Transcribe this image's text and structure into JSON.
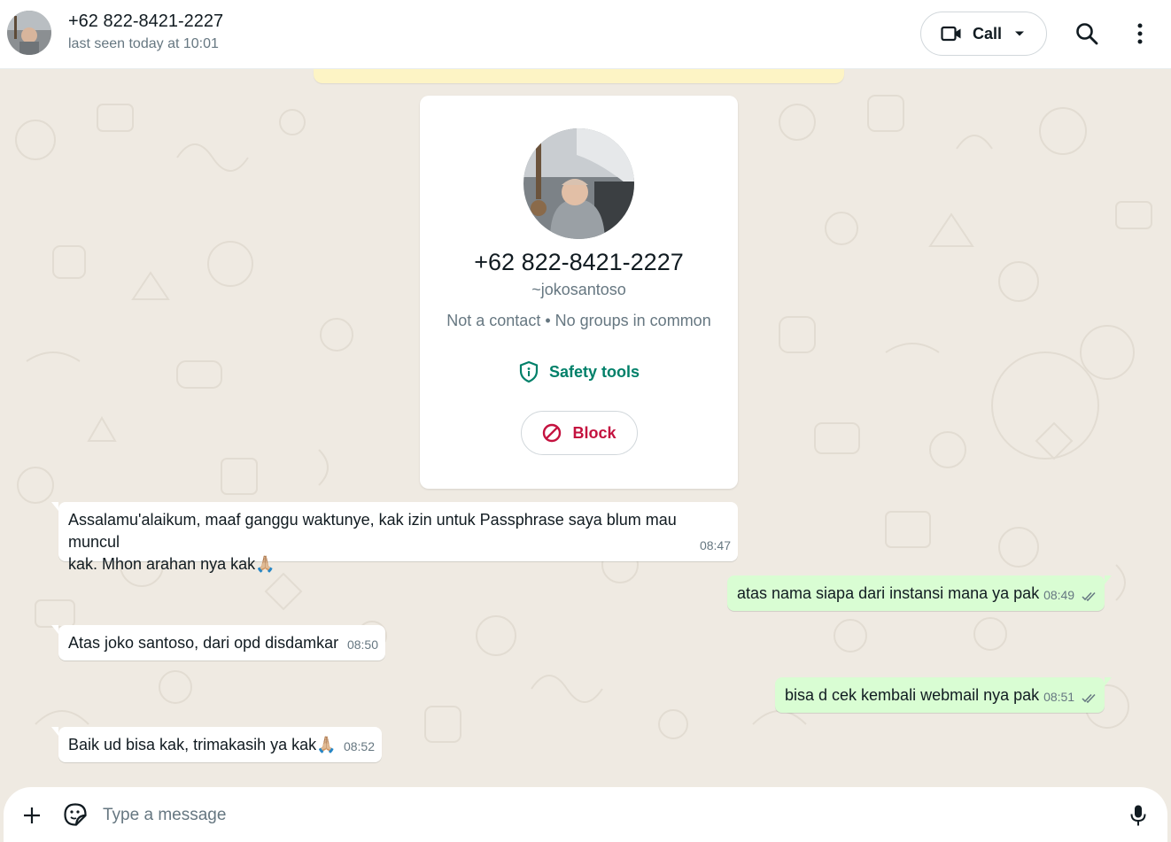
{
  "header": {
    "contact_name": "+62 822-8421-2227",
    "status": "last seen today at 10:01",
    "call_label": "Call"
  },
  "card": {
    "phone": "+62 822-8421-2227",
    "username": "~jokosantoso",
    "info": "Not a contact • No groups in common",
    "safety_label": "Safety tools",
    "block_label": "Block"
  },
  "messages": [
    {
      "direction": "in",
      "lines": [
        "Assalamu'alaikum, maaf ganggu waktunye, kak izin untuk Passphrase saya blum mau muncul",
        "kak. Mhon arahan nya kak🙏🏼"
      ],
      "time": "08:47"
    },
    {
      "direction": "out",
      "text": "atas nama siapa dari instansi mana ya pak",
      "time": "08:49"
    },
    {
      "direction": "in",
      "text": "Atas joko santoso, dari opd disdamkar",
      "time": "08:50"
    },
    {
      "direction": "out",
      "text": "bisa d cek kembali webmail nya pak",
      "time": "08:51"
    },
    {
      "direction": "in",
      "text": "Baik ud bisa kak, trimakasih ya kak🙏🏼",
      "time": "08:52"
    }
  ],
  "composer": {
    "placeholder": "Type a message"
  },
  "colors": {
    "accent": "#008069",
    "block": "#c4123f",
    "outgoing_bubble": "#d9fdd3",
    "chat_bg": "#efeae2"
  },
  "icons": [
    "video-call-icon",
    "chevron-down-icon",
    "search-icon",
    "menu-dots-icon",
    "shield-icon",
    "block-icon",
    "plus-icon",
    "sticker-icon",
    "mic-icon",
    "double-check-icon"
  ]
}
